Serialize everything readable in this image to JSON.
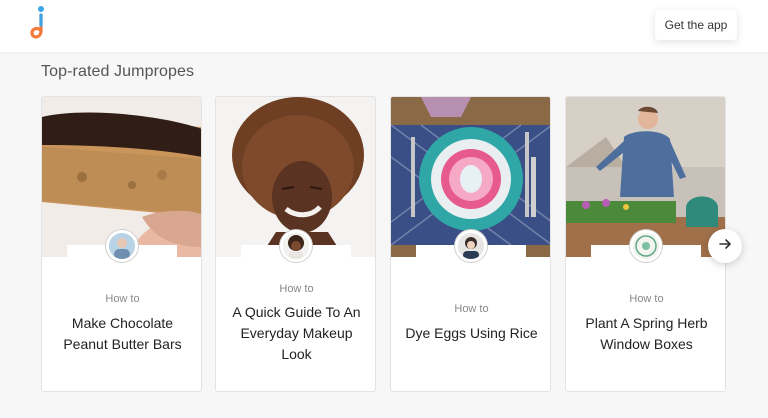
{
  "header": {
    "logo_icon": "jumprope-logo-icon",
    "get_app_label": "Get the app"
  },
  "section": {
    "title": "Top-rated Jumpropes"
  },
  "cards": [
    {
      "prefix": "How to",
      "title": "Make Chocolate Peanut Butter Bars",
      "image": "chocolate-bar-image",
      "avatar": "creator-avatar"
    },
    {
      "prefix": "How to",
      "title": "A Quick Guide To An Everyday Makeup Look",
      "image": "smiling-woman-image",
      "avatar": "creator-avatar"
    },
    {
      "prefix": "How to",
      "title": "Dye Eggs Using Rice",
      "image": "dyed-egg-plate-image",
      "avatar": "creator-avatar"
    },
    {
      "prefix": "How to",
      "title": "Plant A Spring Herb Window Boxes",
      "image": "gardener-planting-image",
      "avatar": "creator-avatar"
    }
  ],
  "carousel": {
    "next_icon": "arrow-right-icon"
  },
  "colors": {
    "background": "#f7f7f7",
    "logo_orange": "#f47a3c",
    "logo_blue": "#3ba5e8"
  }
}
